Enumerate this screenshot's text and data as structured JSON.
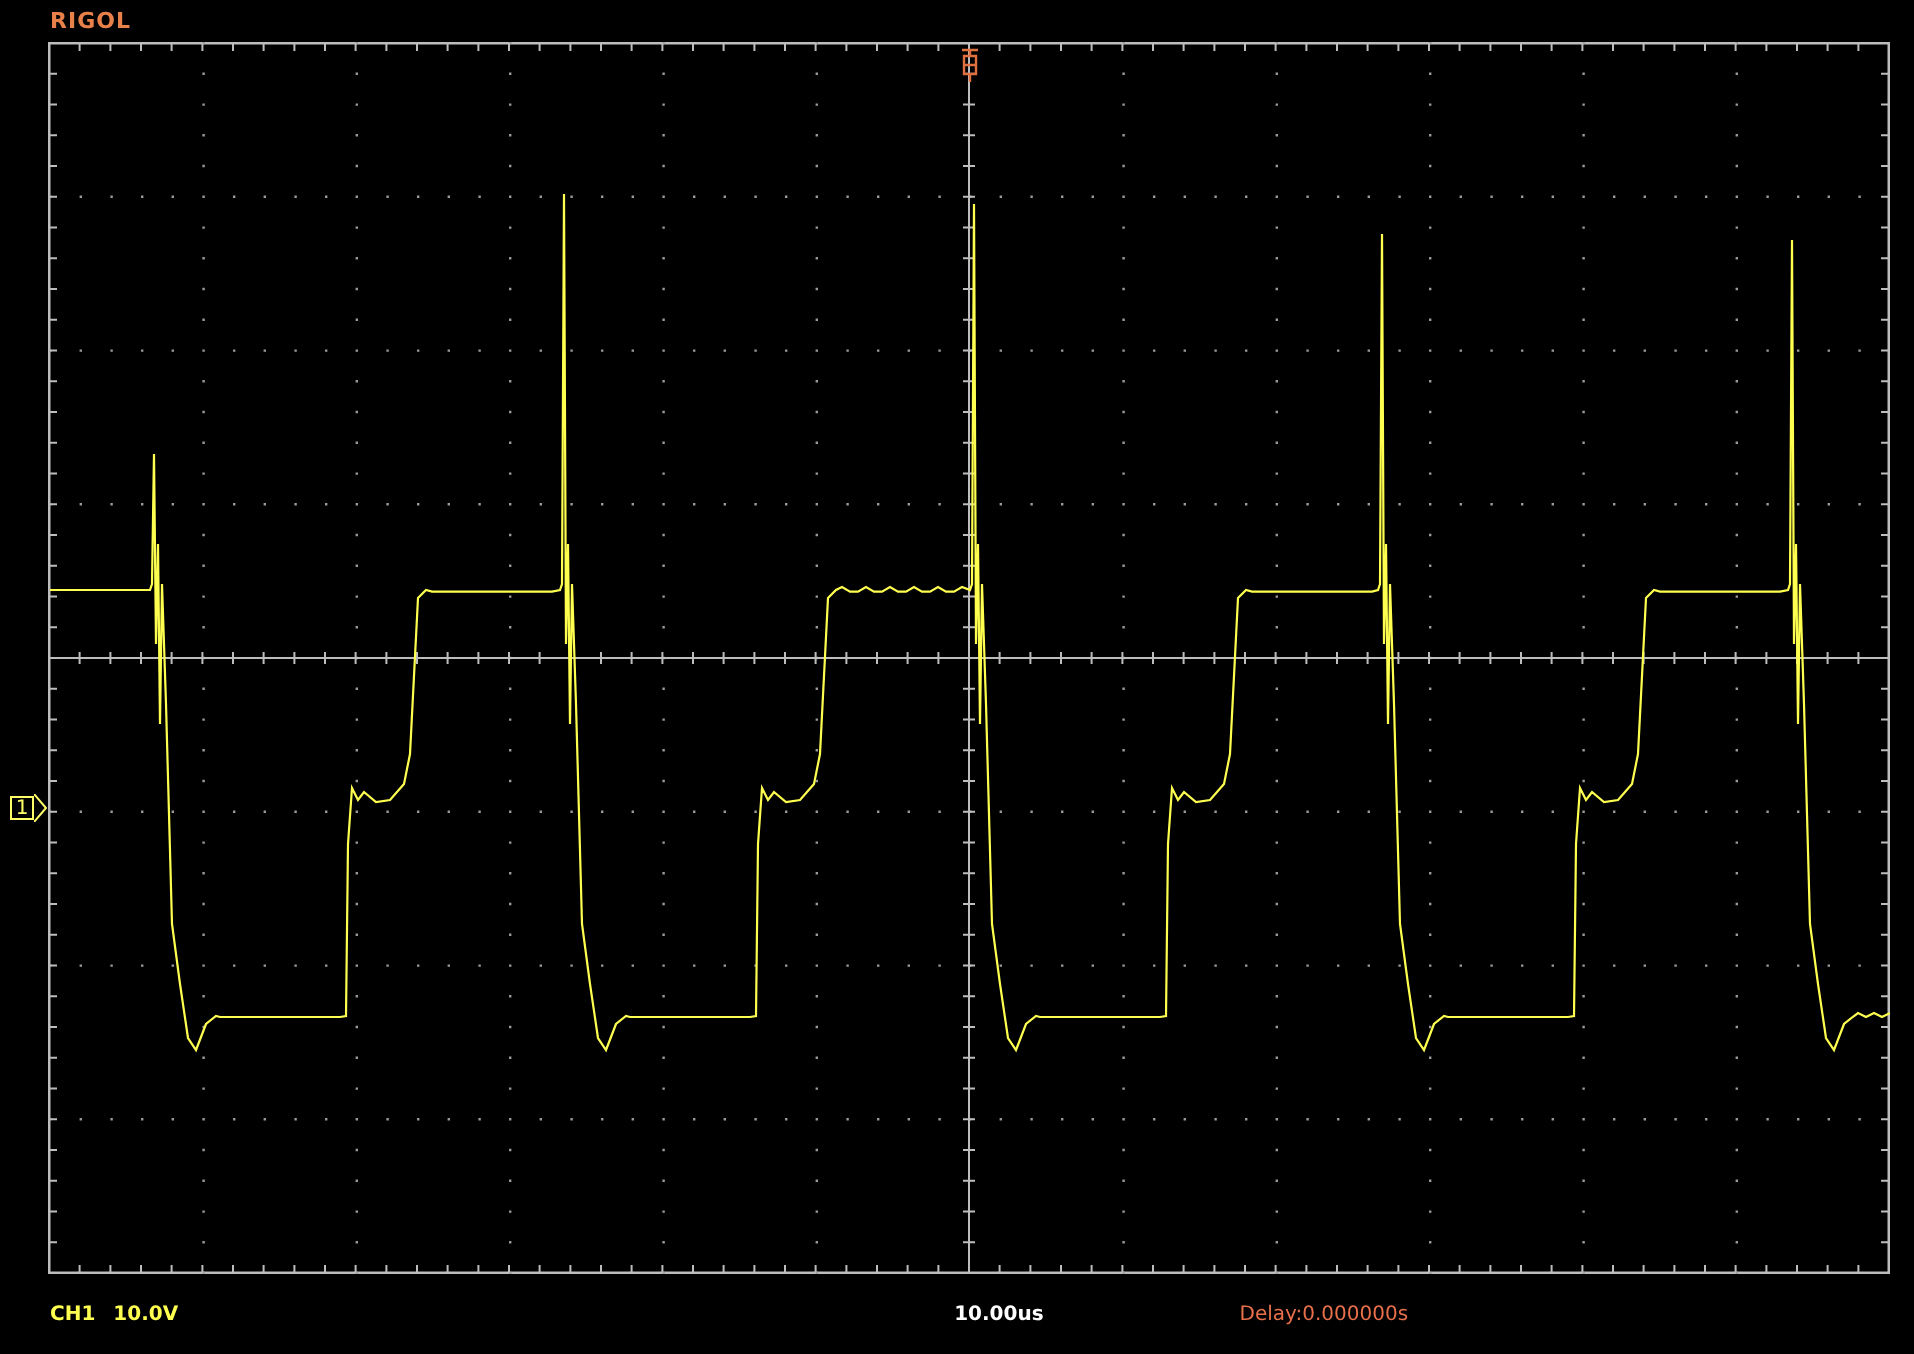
{
  "brand": "RIGOL",
  "channel_marker": "1",
  "status_bar": {
    "channel": "CH1",
    "scale": "10.0V",
    "timebase": "10.00us",
    "delay": "Delay:0.000000s"
  }
}
